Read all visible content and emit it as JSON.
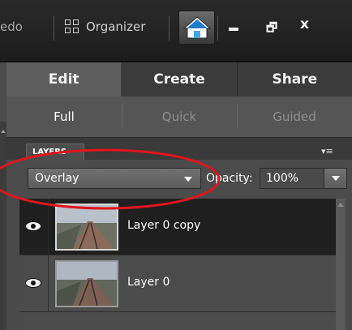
{
  "titlebar": {
    "redo_partial": "edo",
    "organizer_label": "Organizer",
    "minimize_glyph": "",
    "restore_glyph": "🗗",
    "close_glyph": "x"
  },
  "tabs": [
    {
      "label": "Edit",
      "active": true
    },
    {
      "label": "Create",
      "active": false
    },
    {
      "label": "Share",
      "active": false
    }
  ],
  "subtabs": [
    {
      "label": "Full",
      "active": true
    },
    {
      "label": "Quick",
      "active": false
    },
    {
      "label": "Guided",
      "active": false
    }
  ],
  "layers_panel": {
    "title": "LAYERS",
    "menu_glyph": "▾≡",
    "blend_mode": "Overlay",
    "opacity_label": "Opacity:",
    "opacity_value": "100%",
    "layers": [
      {
        "name": "Layer 0 copy",
        "selected": true,
        "visible": true
      },
      {
        "name": "Layer 0",
        "selected": false,
        "visible": true
      }
    ]
  },
  "colors": {
    "annotation": "#e0141c",
    "active_tab": "#5e5e5e",
    "selected_layer": "#1f1f1f"
  },
  "icons": {
    "organizer": "organizer-grid-icon",
    "home": "home-icon",
    "eye": "eye-icon"
  }
}
